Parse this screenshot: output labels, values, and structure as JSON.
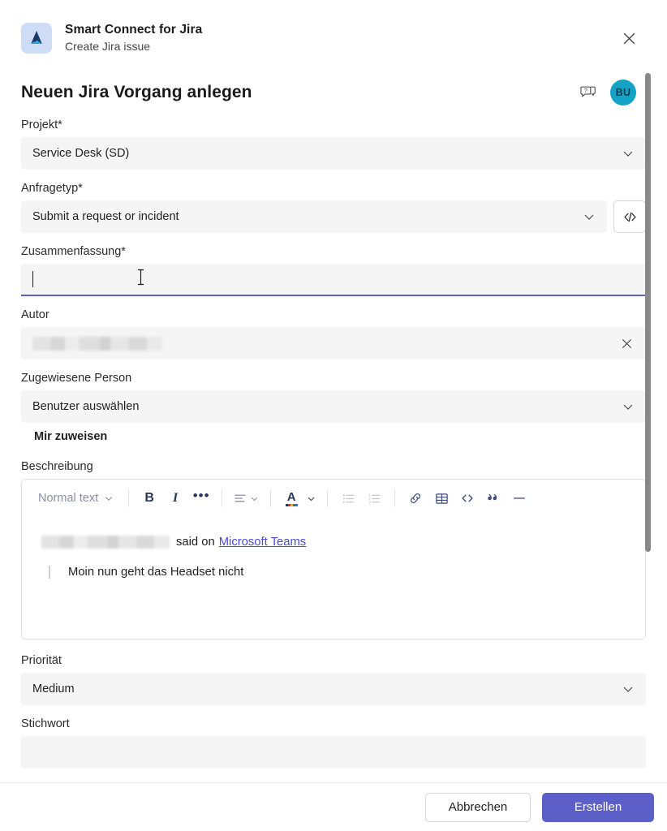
{
  "app": {
    "name": "Smart Connect for Jira",
    "subtitle": "Create Jira issue",
    "icon": "jira-app-icon",
    "close_icon": "close-icon"
  },
  "header": {
    "page_title": "Neuen Jira Vorgang anlegen",
    "help_icon": "help-question-bubble-icon",
    "avatar_initials": "BU",
    "avatar_color": "#14a3c7"
  },
  "form": {
    "project": {
      "label": "Projekt*",
      "value": "Service Desk (SD)"
    },
    "request_type": {
      "label": "Anfragetyp*",
      "value": "Submit a request or incident",
      "code_button_icon": "code-icon"
    },
    "summary": {
      "label": "Zusammenfassung*",
      "value": "",
      "placeholder": "",
      "focused": true
    },
    "author": {
      "label": "Autor",
      "value": "",
      "redacted": true,
      "clear_icon": "close-icon"
    },
    "assignee": {
      "label": "Zugewiesene Person",
      "value": "Benutzer auswählen",
      "assign_to_me_label": "Mir zuweisen"
    },
    "description": {
      "label": "Beschreibung",
      "toolbar": {
        "style_label": "Normal text",
        "bold": "B",
        "italic": "I",
        "more": "…",
        "items": [
          {
            "name": "text-style-dropdown",
            "label": "Normal text"
          },
          {
            "name": "bold-button",
            "label": "B"
          },
          {
            "name": "italic-button",
            "label": "I"
          },
          {
            "name": "more-formatting-button",
            "label": "…"
          },
          {
            "name": "alignment-dropdown",
            "label": ""
          },
          {
            "name": "text-color-dropdown",
            "label": "A"
          },
          {
            "name": "bullet-list-button",
            "label": ""
          },
          {
            "name": "numbered-list-button",
            "label": ""
          },
          {
            "name": "link-button",
            "label": ""
          },
          {
            "name": "table-button",
            "label": ""
          },
          {
            "name": "code-block-button",
            "label": ""
          },
          {
            "name": "quote-button",
            "label": ""
          },
          {
            "name": "horizontal-rule-button",
            "label": ""
          }
        ]
      },
      "content": {
        "attribution_suffix": "said on",
        "source_link": "Microsoft Teams",
        "quote_text": "Moin nun geht das Headset nicht"
      }
    },
    "priority": {
      "label": "Priorität",
      "value": "Medium"
    },
    "keyword": {
      "label": "Stichwort",
      "value": ""
    }
  },
  "footer": {
    "cancel_label": "Abbrechen",
    "submit_label": "Erstellen",
    "primary_color": "#5b5fc7"
  }
}
